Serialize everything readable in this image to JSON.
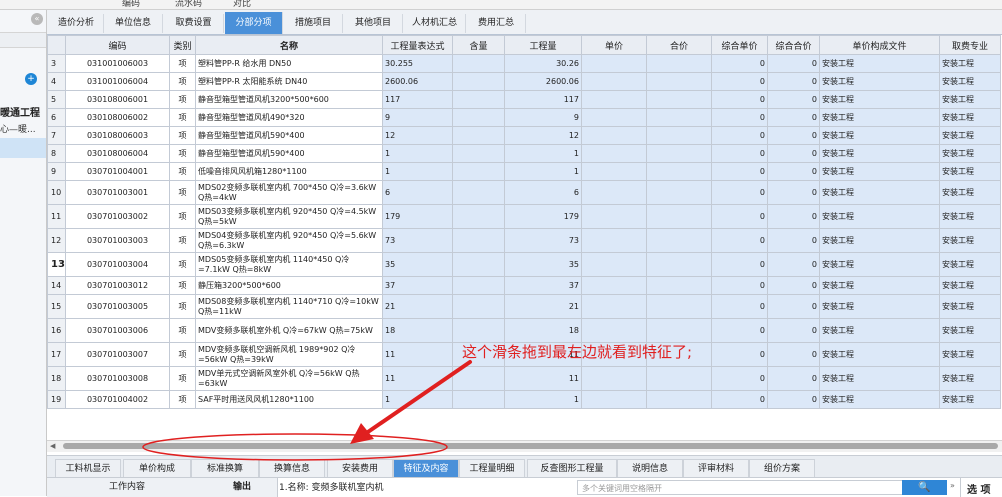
{
  "top_strip": [
    "编码",
    "流水码",
    "对比"
  ],
  "left_panel": {
    "collapse_glyph": "«",
    "add_glyph": "+",
    "project_label": "暖通工程",
    "sub_label": "心—暖..."
  },
  "tabs": [
    {
      "label": "造价分析",
      "active": false
    },
    {
      "label": "单位信息",
      "active": false
    },
    {
      "label": "取费设置",
      "active": false
    },
    {
      "label": "分部分项",
      "active": true
    },
    {
      "label": "措施项目",
      "active": false
    },
    {
      "label": "其他项目",
      "active": false
    },
    {
      "label": "人材机汇总",
      "active": false
    },
    {
      "label": "费用汇总",
      "active": false
    }
  ],
  "columns": [
    "",
    "编码",
    "类别",
    "名称",
    "工程量表达式",
    "含量",
    "工程量",
    "单价",
    "合价",
    "综合单价",
    "综合合价",
    "单价构成文件",
    "取费专业"
  ],
  "rows": [
    {
      "no": "3",
      "code": "031001006003",
      "cat": "项",
      "name": "塑料管PP-R 给水用 DN50",
      "expr": "30.255",
      "content": "",
      "qty": "30.26",
      "price": "",
      "total": "",
      "uprice": "0",
      "utotal": "0",
      "file": "安装工程",
      "spec": "安装工程"
    },
    {
      "no": "4",
      "code": "031001006004",
      "cat": "项",
      "name": "塑料管PP-R 太阳能系统 DN40",
      "expr": "2600.06",
      "content": "",
      "qty": "2600.06",
      "price": "",
      "total": "",
      "uprice": "0",
      "utotal": "0",
      "file": "安装工程",
      "spec": "安装工程"
    },
    {
      "no": "5",
      "code": "030108006001",
      "cat": "项",
      "name": "静音型箱型管道风机3200*500*600",
      "expr": "117",
      "content": "",
      "qty": "117",
      "price": "",
      "total": "",
      "uprice": "0",
      "utotal": "0",
      "file": "安装工程",
      "spec": "安装工程"
    },
    {
      "no": "6",
      "code": "030108006002",
      "cat": "项",
      "name": "静音型箱型管道风机490*320",
      "expr": "9",
      "content": "",
      "qty": "9",
      "price": "",
      "total": "",
      "uprice": "0",
      "utotal": "0",
      "file": "安装工程",
      "spec": "安装工程"
    },
    {
      "no": "7",
      "code": "030108006003",
      "cat": "项",
      "name": "静音型箱型管道风机590*400",
      "expr": "12",
      "content": "",
      "qty": "12",
      "price": "",
      "total": "",
      "uprice": "0",
      "utotal": "0",
      "file": "安装工程",
      "spec": "安装工程"
    },
    {
      "no": "8",
      "code": "030108006004",
      "cat": "项",
      "name": "静音型箱型管道风机590*400",
      "expr": "1",
      "content": "",
      "qty": "1",
      "price": "",
      "total": "",
      "uprice": "0",
      "utotal": "0",
      "file": "安装工程",
      "spec": "安装工程"
    },
    {
      "no": "9",
      "code": "030701004001",
      "cat": "项",
      "name": "低噪音排风风机箱1280*1100",
      "expr": "1",
      "content": "",
      "qty": "1",
      "price": "",
      "total": "",
      "uprice": "0",
      "utotal": "0",
      "file": "安装工程",
      "spec": "安装工程"
    },
    {
      "no": "10",
      "code": "030701003001",
      "cat": "项",
      "name": "MDS02变频多联机室内机 700*450 Q冷=3.6kW Q热=4kW",
      "expr": "6",
      "content": "",
      "qty": "6",
      "price": "",
      "total": "",
      "uprice": "0",
      "utotal": "0",
      "file": "安装工程",
      "spec": "安装工程"
    },
    {
      "no": "11",
      "code": "030701003002",
      "cat": "项",
      "name": "MDS03变频多联机室内机 920*450 Q冷=4.5kW Q热=5kW",
      "expr": "179",
      "content": "",
      "qty": "179",
      "price": "",
      "total": "",
      "uprice": "0",
      "utotal": "0",
      "file": "安装工程",
      "spec": "安装工程"
    },
    {
      "no": "12",
      "code": "030701003003",
      "cat": "项",
      "name": "MDS04变频多联机室内机 920*450 Q冷=5.6kW Q热=6.3kW",
      "expr": "73",
      "content": "",
      "qty": "73",
      "price": "",
      "total": "",
      "uprice": "0",
      "utotal": "0",
      "file": "安装工程",
      "spec": "安装工程"
    },
    {
      "no": "13",
      "code": "030701003004",
      "cat": "项",
      "name": "MDS05变频多联机室内机 1140*450 Q冷=7.1kW Q热=8kW",
      "expr": "35",
      "content": "",
      "qty": "35",
      "price": "",
      "total": "",
      "uprice": "0",
      "utotal": "0",
      "file": "安装工程",
      "spec": "安装工程"
    },
    {
      "no": "14",
      "code": "030701003012",
      "cat": "项",
      "name": "静压箱3200*500*600",
      "expr": "37",
      "content": "",
      "qty": "37",
      "price": "",
      "total": "",
      "uprice": "0",
      "utotal": "0",
      "file": "安装工程",
      "spec": "安装工程"
    },
    {
      "no": "15",
      "code": "030701003005",
      "cat": "项",
      "name": "MDS08变频多联机室内机 1140*710 Q冷=10kW Q热=11kW",
      "expr": "21",
      "content": "",
      "qty": "21",
      "price": "",
      "total": "",
      "uprice": "0",
      "utotal": "0",
      "file": "安装工程",
      "spec": "安装工程"
    },
    {
      "no": "16",
      "code": "030701003006",
      "cat": "项",
      "name": "MDV变频多联机室外机 Q冷=67kW Q热=75kW",
      "expr": "18",
      "content": "",
      "qty": "18",
      "price": "",
      "total": "",
      "uprice": "0",
      "utotal": "0",
      "file": "安装工程",
      "spec": "安装工程"
    },
    {
      "no": "17",
      "code": "030701003007",
      "cat": "项",
      "name": "MDV变频多联机空调新风机 1989*902 Q冷=56kW Q热=39kW",
      "expr": "11",
      "content": "",
      "qty": "11",
      "price": "",
      "total": "",
      "uprice": "0",
      "utotal": "0",
      "file": "安装工程",
      "spec": "安装工程"
    },
    {
      "no": "18",
      "code": "030701003008",
      "cat": "项",
      "name": "MDV单元式空调新风室外机 Q冷=56kW Q热=63kW",
      "expr": "11",
      "content": "",
      "qty": "11",
      "price": "",
      "total": "",
      "uprice": "0",
      "utotal": "0",
      "file": "安装工程",
      "spec": "安装工程"
    },
    {
      "no": "19",
      "code": "030701004002",
      "cat": "项",
      "name": "SAF平时用送风风机1280*1100",
      "expr": "1",
      "content": "",
      "qty": "1",
      "price": "",
      "total": "",
      "uprice": "0",
      "utotal": "0",
      "file": "安装工程",
      "spec": "安装工程"
    }
  ],
  "current_row": "13",
  "annotation": "这个滑条拖到最左边就看到特征了;",
  "bottom_tabs": [
    {
      "label": "工料机显示",
      "active": false
    },
    {
      "label": "单价构成",
      "active": false
    },
    {
      "label": "标准换算",
      "active": false
    },
    {
      "label": "换算信息",
      "active": false
    },
    {
      "label": "安装费用",
      "active": false
    },
    {
      "label": "特征及内容",
      "active": true
    },
    {
      "label": "工程量明细",
      "active": false
    },
    {
      "label": "反查图形工程量",
      "active": false
    },
    {
      "label": "说明信息",
      "active": false
    },
    {
      "label": "评审材料",
      "active": false
    },
    {
      "label": "组价方案",
      "active": false
    }
  ],
  "bottom_panel": {
    "work_content": "工作内容",
    "output": "输出",
    "feature_line": "1.名称: 变频多联机室内机",
    "search_placeholder": "多个关键词用空格隔开",
    "options": "选 项",
    "expand_glyph": "»",
    "search_glyph": "🔍"
  },
  "colors": {
    "accent": "#4a90d9",
    "cell_blue": "#dce8f8",
    "annotation": "#e02020"
  }
}
